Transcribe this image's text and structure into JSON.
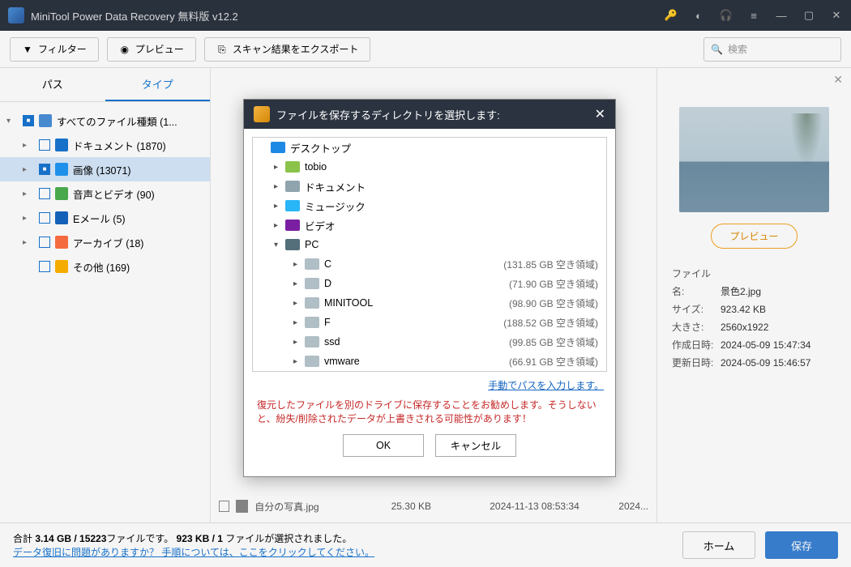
{
  "titlebar": {
    "app_title": "MiniTool Power Data Recovery 無料版 v12.2"
  },
  "toolbar": {
    "filter": "フィルター",
    "preview": "プレビュー",
    "export": "スキャン結果をエクスポート",
    "search_placeholder": "検索"
  },
  "sidebar": {
    "tab_path": "パス",
    "tab_type": "タイプ",
    "items": [
      {
        "label": "すべてのファイル種類 (1...",
        "icon": "#4a90d9",
        "sel": false,
        "cb": "full",
        "chev": "v",
        "lvl": 0
      },
      {
        "label": "ドキュメント (1870)",
        "icon": "#1976d2",
        "sel": false,
        "cb": "empty",
        "chev": ">",
        "lvl": 1
      },
      {
        "label": "画像 (13071)",
        "icon": "#2196f3",
        "sel": true,
        "cb": "full",
        "chev": ">",
        "lvl": 1
      },
      {
        "label": "音声とビデオ (90)",
        "icon": "#4caf50",
        "sel": false,
        "cb": "empty",
        "chev": ">",
        "lvl": 1
      },
      {
        "label": "Eメール (5)",
        "icon": "#1565c0",
        "sel": false,
        "cb": "empty",
        "chev": ">",
        "lvl": 1
      },
      {
        "label": "アーカイブ (18)",
        "icon": "#ff7043",
        "sel": false,
        "cb": "empty",
        "chev": ">",
        "lvl": 1
      },
      {
        "label": "その他 (169)",
        "icon": "#ffb300",
        "sel": false,
        "cb": "empty",
        "chev": "",
        "lvl": 1
      }
    ]
  },
  "file_row": {
    "name": "自分の写真.jpg",
    "size": "25.30 KB",
    "date": "2024-11-13 08:53:34",
    "extra": "2024..."
  },
  "preview": {
    "btn": "プレビュー",
    "meta": [
      {
        "k": "ファイル名:",
        "v": "景色2.jpg"
      },
      {
        "k": "サイズ:",
        "v": "923.42 KB"
      },
      {
        "k": "大きさ:",
        "v": "2560x1922"
      },
      {
        "k": "作成日時:",
        "v": "2024-05-09 15:47:34"
      },
      {
        "k": "更新日時:",
        "v": "2024-05-09 15:46:57"
      }
    ]
  },
  "footer": {
    "line1a": "合計 ",
    "line1b": "3.14 GB / 15223",
    "line1c": "ファイルです。 ",
    "line1d": "923 KB / 1",
    "line1e": " ファイルが選択されました。",
    "link": "データ復旧に問題がありますか？ 手順については、ここをクリックしてください。",
    "home": "ホーム",
    "save": "保存"
  },
  "modal": {
    "title": "ファイルを保存するディレクトリを選択します:",
    "tree": [
      {
        "name": "デスクトップ",
        "chev": "",
        "lvl": 0,
        "color": "#1e88e5",
        "info": ""
      },
      {
        "name": "tobio",
        "chev": ">",
        "lvl": 1,
        "color": "#8bc34a",
        "info": ""
      },
      {
        "name": "ドキュメント",
        "chev": ">",
        "lvl": 1,
        "color": "#90a4ae",
        "info": ""
      },
      {
        "name": "ミュージック",
        "chev": ">",
        "lvl": 1,
        "color": "#29b6f6",
        "info": ""
      },
      {
        "name": "ビデオ",
        "chev": ">",
        "lvl": 1,
        "color": "#7b1fa2",
        "info": ""
      },
      {
        "name": "PC",
        "chev": "v",
        "lvl": 1,
        "color": "#546e7a",
        "info": ""
      },
      {
        "name": "C",
        "chev": ">",
        "lvl": 2,
        "color": "#b0bec5",
        "info": "(131.85 GB 空き領域)"
      },
      {
        "name": "D",
        "chev": ">",
        "lvl": 2,
        "color": "#b0bec5",
        "info": "(71.90 GB 空き領域)"
      },
      {
        "name": "MINITOOL",
        "chev": ">",
        "lvl": 2,
        "color": "#b0bec5",
        "info": "(98.90 GB 空き領域)"
      },
      {
        "name": "F",
        "chev": ">",
        "lvl": 2,
        "color": "#b0bec5",
        "info": "(188.52 GB 空き領域)"
      },
      {
        "name": "ssd",
        "chev": ">",
        "lvl": 2,
        "color": "#b0bec5",
        "info": "(99.85 GB 空き領域)"
      },
      {
        "name": "vmware",
        "chev": ">",
        "lvl": 2,
        "color": "#b0bec5",
        "info": "(66.91 GB 空き領域)"
      }
    ],
    "manual": "手動でパスを入力します。",
    "warn": "復元したファイルを別のドライブに保存することをお勧めします。そうしないと、紛失/削除されたデータが上書きされる可能性があります！",
    "ok": "OK",
    "cancel": "キャンセル"
  }
}
